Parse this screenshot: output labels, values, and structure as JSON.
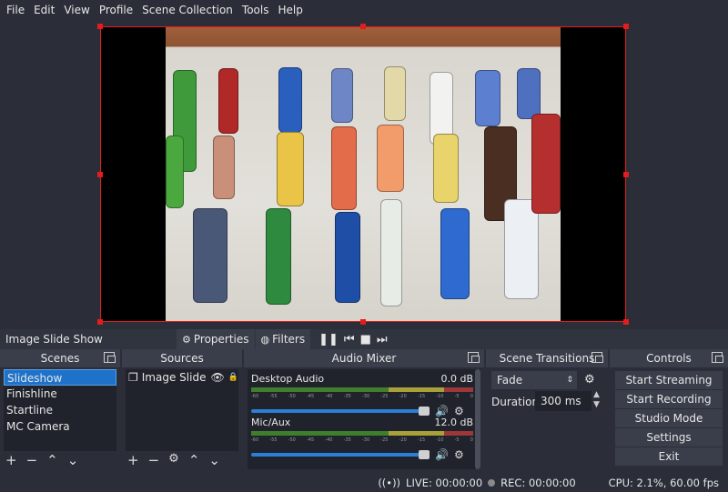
{
  "menu": [
    "File",
    "Edit",
    "View",
    "Profile",
    "Scene Collection",
    "Tools",
    "Help"
  ],
  "source_toolbar": {
    "current_source": "Image Slide Show",
    "properties_label": "Properties",
    "filters_label": "Filters"
  },
  "scenes": {
    "title": "Scenes",
    "items": [
      "Slideshow",
      "Finishline",
      "Startline",
      "MC Camera"
    ],
    "selected": "Slideshow"
  },
  "sources": {
    "title": "Sources",
    "items": [
      "Image Slide Sh"
    ]
  },
  "audio_mixer": {
    "title": "Audio Mixer",
    "channels": [
      {
        "name": "Desktop Audio",
        "level": "0.0 dB",
        "volume_fraction": 1.0
      },
      {
        "name": "Mic/Aux",
        "level": "12.0 dB",
        "volume_fraction": 1.0
      }
    ],
    "scale": [
      "-60",
      "-55",
      "-50",
      "-45",
      "-40",
      "-35",
      "-30",
      "-25",
      "-20",
      "-15",
      "-10",
      "-5",
      "0"
    ]
  },
  "scene_transitions": {
    "title": "Scene Transitions",
    "transition": "Fade",
    "duration_label": "Duration",
    "duration_value": "300 ms"
  },
  "controls": {
    "title": "Controls",
    "start_streaming": "Start Streaming",
    "start_recording": "Start Recording",
    "studio_mode": "Studio Mode",
    "settings": "Settings",
    "exit": "Exit"
  },
  "status": {
    "live": "LIVE: 00:00:00",
    "rec": "REC: 00:00:00",
    "cpu": "CPU: 2.1%, 60.00 fps"
  },
  "colors": {
    "selection": "#e51c1c",
    "accent": "#1e72c9"
  }
}
